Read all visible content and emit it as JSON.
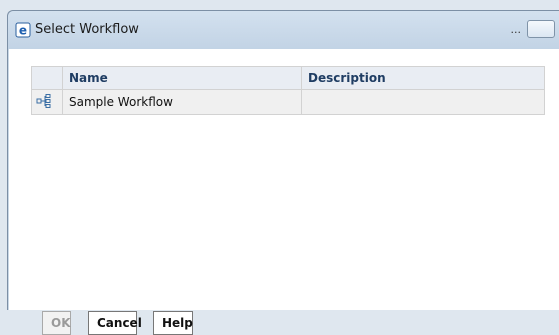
{
  "window": {
    "title": "Select Workflow",
    "title_icon": "internet-explorer-icon",
    "dots": "..."
  },
  "table": {
    "headers": [
      "",
      "Name",
      "Description"
    ],
    "rows": [
      {
        "icon": "workflow-icon",
        "name": "Sample Workflow",
        "description": ""
      }
    ]
  },
  "buttons": {
    "ok": "OK",
    "cancel": "Cancel",
    "help": "Help"
  },
  "colors": {
    "title_bg": "#c9d8e7",
    "header_text": "#1f3d63",
    "disabled_text": "#9a9a9a"
  }
}
